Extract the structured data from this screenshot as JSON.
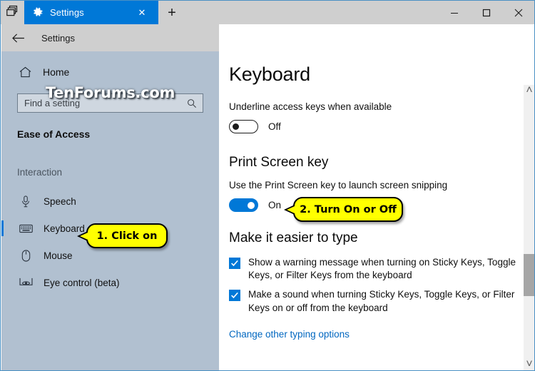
{
  "window": {
    "sets_icon": "tab-list-icon",
    "minimize_label": "–",
    "maximize_label": "□",
    "close_label": "✕"
  },
  "tab": {
    "icon": "gear-icon",
    "title": "Settings",
    "close_label": "✕",
    "new_tab_label": "+"
  },
  "header": {
    "back_label": "←",
    "title": "Settings"
  },
  "sidebar": {
    "home_label": "Home",
    "home_icon": "home-icon",
    "watermark": "TenForums.com",
    "search": {
      "placeholder": "Find a setting",
      "icon": "search-icon"
    },
    "category": "Ease of Access",
    "group": "Interaction",
    "items": [
      {
        "label": "Speech",
        "icon": "microphone-icon",
        "selected": false
      },
      {
        "label": "Keyboard",
        "icon": "keyboard-icon",
        "selected": true
      },
      {
        "label": "Mouse",
        "icon": "mouse-icon",
        "selected": false
      },
      {
        "label": "Eye control (beta)",
        "icon": "eye-control-icon",
        "selected": false
      }
    ]
  },
  "content": {
    "page_title": "Keyboard",
    "underline": {
      "label": "Underline access keys when available",
      "state": "Off",
      "on": false
    },
    "print_screen": {
      "heading": "Print Screen key",
      "label": "Use the Print Screen key to launch screen snipping",
      "state": "On",
      "on": true
    },
    "easier_to_type": {
      "heading": "Make it easier to type",
      "checkboxes": [
        {
          "label": "Show a warning message when turning on Sticky Keys, Toggle Keys, or Filter Keys from the keyboard",
          "checked": true
        },
        {
          "label": "Make a sound when turning Sticky Keys, Toggle Keys, or Filter Keys on or off from the keyboard",
          "checked": true
        }
      ],
      "link": "Change other typing options"
    },
    "scrollbar": {
      "up_arrow": "˄",
      "down_arrow": "˅"
    }
  },
  "callouts": [
    {
      "text": "1. Click on"
    },
    {
      "text": "2. Turn On or Off"
    }
  ],
  "colors": {
    "accent": "#0078d7",
    "sidebar_bg": "#b1c0d0",
    "titlebar_bg": "#cfcfcf",
    "callout_bg": "#ffff00",
    "link": "#0067c0"
  }
}
